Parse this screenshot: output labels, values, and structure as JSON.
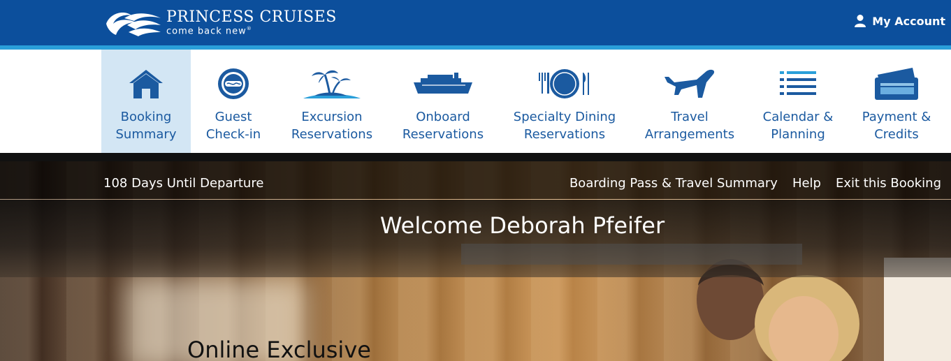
{
  "brand": {
    "name": "PRINCESS CRUISES",
    "tagline": "come back new",
    "trademark": "®",
    "colors": {
      "bar": "#0c4f9c",
      "stripe": "#2a9fd9",
      "nav_text": "#1b5aa0",
      "active_bg": "#d3e6f4"
    }
  },
  "header": {
    "account_label": "My Account"
  },
  "nav": {
    "items": [
      {
        "label": "Booking\nSummary",
        "icon": "house-icon",
        "active": true
      },
      {
        "label": "Guest\nCheck-in",
        "icon": "life-ring-icon",
        "active": false
      },
      {
        "label": "Excursion\nReservations",
        "icon": "palm-island-icon",
        "active": false
      },
      {
        "label": "Onboard\nReservations",
        "icon": "ship-icon",
        "active": false
      },
      {
        "label": "Specialty Dining\nReservations",
        "icon": "dining-plate-icon",
        "active": false
      },
      {
        "label": "Travel\nArrangements",
        "icon": "airplane-icon",
        "active": false
      },
      {
        "label": "Calendar &\nPlanning",
        "icon": "list-icon",
        "active": false
      },
      {
        "label": "Payment &\nCredits",
        "icon": "credit-card-icon",
        "active": false
      }
    ]
  },
  "subnav": {
    "countdown": "108 Days Until Departure",
    "links": [
      "Boarding Pass & Travel Summary",
      "Help",
      "Exit this Booking"
    ]
  },
  "hero": {
    "welcome": "Welcome Deborah Pfeifer",
    "promo_title": "Online Exclusive"
  }
}
